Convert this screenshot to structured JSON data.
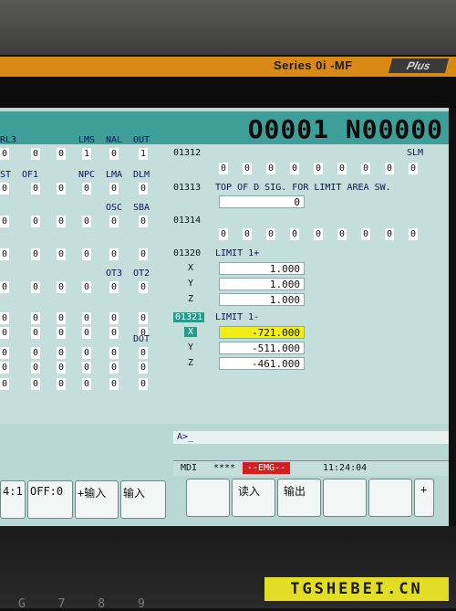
{
  "bezel": {
    "series": "Series 0i -MF",
    "plus": "Plus"
  },
  "header": {
    "program": "O0001 N00000"
  },
  "left_params": [
    {
      "labels": [
        {
          "t": "RL3",
          "x": 0
        },
        {
          "t": "LMS",
          "x": 86
        },
        {
          "t": "NAL",
          "x": 116
        },
        {
          "t": "OUT",
          "x": 146
        }
      ],
      "bits": [
        0,
        0,
        0,
        1,
        0,
        1
      ],
      "bit_x": [
        0,
        34,
        62,
        90,
        120,
        152
      ]
    },
    {
      "labels": [
        {
          "t": "ST",
          "x": 0
        },
        {
          "t": "OF1",
          "x": 24
        },
        {
          "t": "NPC",
          "x": 86
        },
        {
          "t": "LMA",
          "x": 116
        },
        {
          "t": "DLM",
          "x": 146
        }
      ],
      "bits": [
        0,
        0,
        0,
        0,
        0,
        0
      ],
      "bit_x": [
        0,
        34,
        62,
        90,
        120,
        152
      ]
    },
    {
      "labels": [
        {
          "t": "OSC",
          "x": 116
        },
        {
          "t": "SBA",
          "x": 146
        }
      ],
      "bits": [
        0,
        0,
        0,
        0,
        0,
        0
      ],
      "bit_x": [
        0,
        34,
        62,
        90,
        120,
        152
      ]
    },
    {
      "labels": [],
      "bits": [
        0,
        0,
        0,
        0,
        0,
        0
      ],
      "bit_x": [
        0,
        34,
        62,
        90,
        120,
        152
      ]
    },
    {
      "labels": [
        {
          "t": "OT3",
          "x": 116
        },
        {
          "t": "OT2",
          "x": 146
        }
      ],
      "bits": [
        0,
        0,
        0,
        0,
        0,
        0
      ],
      "bit_x": [
        0,
        34,
        62,
        90,
        120,
        152
      ]
    },
    {
      "labels": [],
      "bits": [
        0,
        0,
        0,
        0,
        0,
        0
      ],
      "bit_x": [
        0,
        34,
        62,
        90,
        120,
        152
      ]
    },
    {
      "labels": [],
      "bits": [
        0,
        0,
        0,
        0,
        0,
        0
      ],
      "bit_x": [
        0,
        34,
        62,
        90,
        120,
        152
      ]
    },
    {
      "labels": [
        {
          "t": "DOT",
          "x": 146
        }
      ],
      "bits": [
        0,
        0,
        0,
        0,
        0,
        0
      ],
      "bit_x": [
        0,
        34,
        62,
        90,
        120,
        152
      ]
    },
    {
      "labels": [],
      "bits": [
        0,
        0,
        0,
        0,
        0,
        0
      ],
      "bit_x": [
        0,
        34,
        62,
        90,
        120,
        152
      ]
    },
    {
      "labels": [],
      "bits": [
        0,
        0,
        0,
        0,
        0,
        0
      ],
      "bit_x": [
        0,
        34,
        62,
        90,
        120,
        152
      ]
    }
  ],
  "p01312": {
    "num": "01312",
    "label": "SLM",
    "bits": [
      0,
      0,
      0,
      0,
      0,
      0,
      0,
      0,
      0
    ]
  },
  "p01313": {
    "num": "01313",
    "label": "TOP OF D SIG. FOR LIMIT AREA SW.",
    "value": "0"
  },
  "p01314": {
    "num": "01314",
    "bits": [
      0,
      0,
      0,
      0,
      0,
      0,
      0,
      0,
      0
    ]
  },
  "p01320": {
    "num": "01320",
    "label": "LIMIT 1+",
    "axes": [
      {
        "a": "X",
        "v": "1.000"
      },
      {
        "a": "Y",
        "v": "1.000"
      },
      {
        "a": "Z",
        "v": "1.000"
      }
    ]
  },
  "p01321": {
    "num": "01321",
    "label": "LIMIT 1-",
    "axes": [
      {
        "a": "X",
        "v": "-721.000"
      },
      {
        "a": "Y",
        "v": "-511.000"
      },
      {
        "a": "Z",
        "v": "-461.000"
      }
    ]
  },
  "input": {
    "prompt": "A>_"
  },
  "status": {
    "mode": "MDI",
    "stars": "****",
    "emg": "--EMG--",
    "time": "11:24:04"
  },
  "softkeys_left": [
    "4:1",
    "OFF:0",
    "+输入",
    "输入"
  ],
  "softkeys_right": [
    "",
    "读入",
    "输出",
    "",
    "",
    "+"
  ],
  "watermark": "TGSHEBEI.CN",
  "keys": "G 7 8 9"
}
